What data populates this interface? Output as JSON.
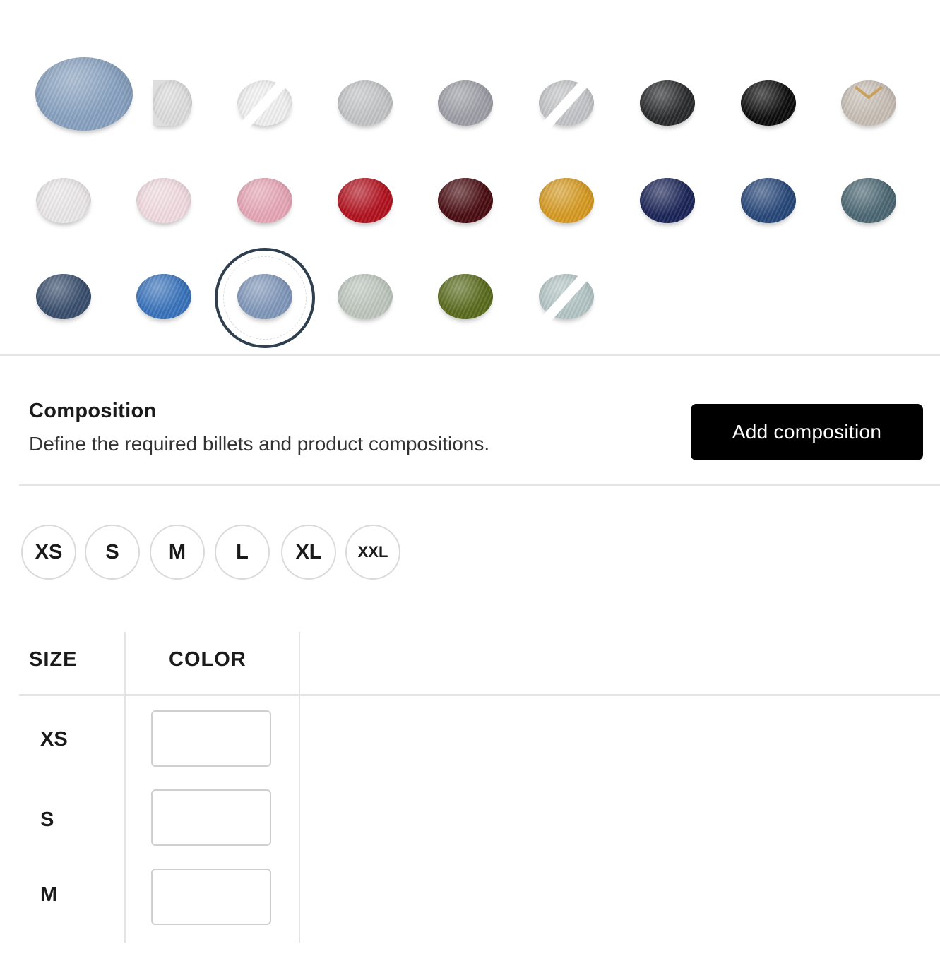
{
  "swatches": [
    {
      "color": "#89a3c2",
      "large": true
    },
    {
      "color": "#dedede",
      "cut": true
    },
    {
      "color": "#f2f2f2",
      "unavailable": true
    },
    {
      "color": "#c5c6c8"
    },
    {
      "color": "#9fa0a8"
    },
    {
      "color": "#c4c6c9",
      "unavailable": true
    },
    {
      "color": "#2a2b2d"
    },
    {
      "color": "#0d0d0e"
    },
    {
      "color": "#c9c0b7",
      "accent": "#c9a15e"
    },
    {
      "color": "#ede9ea"
    },
    {
      "color": "#f3dde3"
    },
    {
      "color": "#e8a8b8"
    },
    {
      "color": "#b3121f"
    },
    {
      "color": "#4a0d12"
    },
    {
      "color": "#d79b22"
    },
    {
      "color": "#1b2558"
    },
    {
      "color": "#28487a"
    },
    {
      "color": "#4c6874"
    },
    {
      "color": "#3a4f6e"
    },
    {
      "color": "#3a74bd"
    },
    {
      "color": "#8299bc",
      "selected": true
    },
    {
      "color": "#bfc8bf"
    },
    {
      "color": "#5b6d1e"
    },
    {
      "color": "#b6c7c7",
      "unavailable": true
    }
  ],
  "composition": {
    "title": "Composition",
    "description": "Define the required billets and product compositions.",
    "button_label": "Add composition"
  },
  "size_chips": [
    "XS",
    "S",
    "M",
    "L",
    "XL",
    "XXL"
  ],
  "table": {
    "headers": {
      "size": "SIZE",
      "color": "COLOR"
    },
    "rows": [
      {
        "size": "XS",
        "color_value": ""
      },
      {
        "size": "S",
        "color_value": ""
      },
      {
        "size": "M",
        "color_value": ""
      }
    ]
  }
}
